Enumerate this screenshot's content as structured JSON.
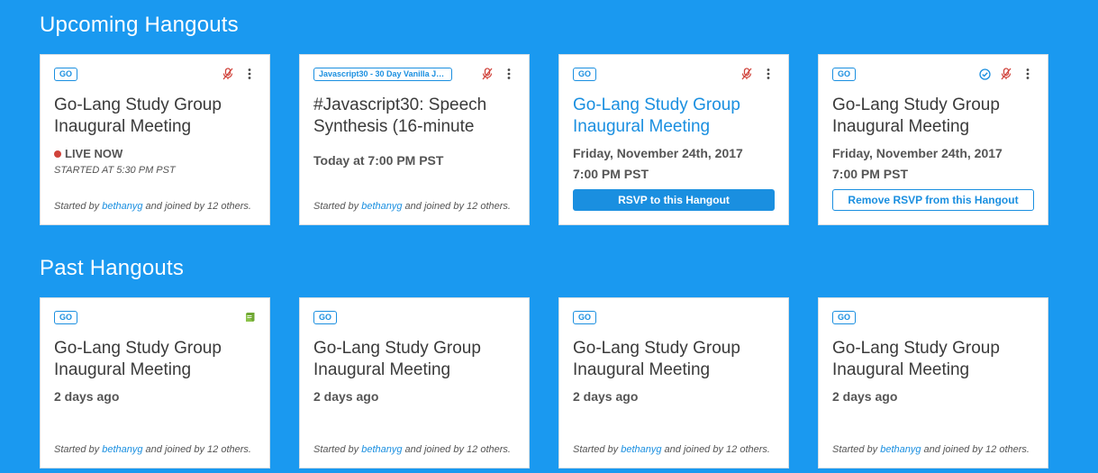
{
  "colors": {
    "background": "#1a99f0",
    "accent": "#1a8fe0",
    "live": "#d0433b",
    "book": "#8bc34a",
    "mic_off": "#d0433b"
  },
  "upcoming": {
    "title": "Upcoming Hangouts",
    "cards": [
      {
        "tag": "GO",
        "title": "Go-Lang Study Group Inaugural Meeting",
        "live_label": "LIVE NOW",
        "started_at": "STARTED AT 5:30 PM PST",
        "by_prefix": "Started by",
        "by_user": "bethanyg",
        "by_suffix": "and joined by 12 others.",
        "icons": [
          "mic-off-icon",
          "more-vert-icon"
        ]
      },
      {
        "tag": "Javascript30 - 30 Day Vanilla JS Coding Challenge",
        "title": "#Javascript30: Speech Synthesis (16-minute",
        "time": "Today at 7:00 PM PST",
        "by_prefix": "Started by",
        "by_user": "bethanyg",
        "by_suffix": "and joined by 12 others.",
        "icons": [
          "mic-off-icon",
          "more-vert-icon"
        ]
      },
      {
        "tag": "GO",
        "title": "Go-Lang Study Group Inaugural Meeting",
        "date": "Friday, November 24th, 2017",
        "time": "7:00 PM PST",
        "button": "RSVP to this Hangout",
        "icons": [
          "mic-off-icon",
          "more-vert-icon"
        ]
      },
      {
        "tag": "GO",
        "title": "Go-Lang Study Group Inaugural Meeting",
        "date": "Friday, November 24th, 2017",
        "time": "7:00 PM PST",
        "button": "Remove RSVP from this Hangout",
        "icons": [
          "check-circle-icon",
          "mic-off-icon",
          "more-vert-icon"
        ]
      }
    ]
  },
  "past": {
    "title": "Past Hangouts",
    "cards": [
      {
        "tag": "GO",
        "title": "Go-Lang Study Group Inaugural Meeting",
        "time": "2 days ago",
        "by_prefix": "Started by",
        "by_user": "bethanyg",
        "by_suffix": "and joined by 12 others.",
        "icons": [
          "book-icon"
        ]
      },
      {
        "tag": "GO",
        "title": "Go-Lang Study Group Inaugural Meeting",
        "time": "2 days ago",
        "by_prefix": "Started by",
        "by_user": "bethanyg",
        "by_suffix": "and joined by 12 others."
      },
      {
        "tag": "GO",
        "title": "Go-Lang Study Group Inaugural Meeting",
        "time": "2 days ago",
        "by_prefix": "Started by",
        "by_user": "bethanyg",
        "by_suffix": "and joined by 12 others."
      },
      {
        "tag": "GO",
        "title": "Go-Lang Study Group Inaugural Meeting",
        "time": "2 days ago",
        "by_prefix": "Started by",
        "by_user": "bethanyg",
        "by_suffix": "and joined by 12 others."
      }
    ]
  }
}
